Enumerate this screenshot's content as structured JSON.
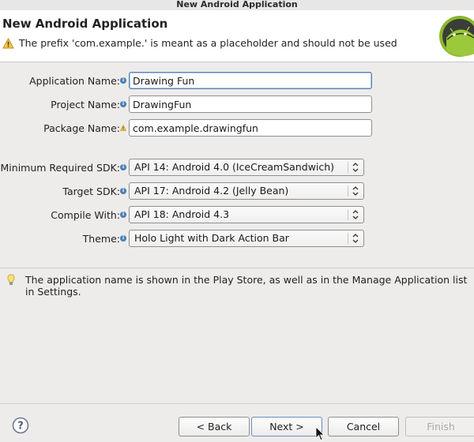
{
  "window": {
    "title": "New Android Application"
  },
  "header": {
    "title": "New Android Application",
    "message": "The prefix 'com.example.' is meant as a placeholder and should not be used",
    "message_icon": "warning-icon",
    "logo": "android-logo"
  },
  "form": {
    "fields": [
      {
        "label": "Application Name:",
        "icon": "info-icon",
        "value": "Drawing Fun",
        "focused": true
      },
      {
        "label": "Project Name:",
        "icon": "info-icon",
        "value": "DrawingFun"
      },
      {
        "label": "Package Name:",
        "icon": "warning-icon",
        "value": "com.example.drawingfun"
      }
    ],
    "selects": [
      {
        "label": "Minimum Required SDK:",
        "icon": "info-icon",
        "value": "API 14: Android 4.0 (IceCreamSandwich)"
      },
      {
        "label": "Target SDK:",
        "icon": "info-icon",
        "value": "API 17: Android 4.2 (Jelly Bean)"
      },
      {
        "label": "Compile With:",
        "icon": "info-icon",
        "value": "API 18: Android 4.3"
      },
      {
        "label": "Theme:",
        "icon": "info-icon",
        "value": "Holo Light with Dark Action Bar"
      }
    ]
  },
  "hint": {
    "icon": "lightbulb-icon",
    "text": "The application name is shown in the Play Store, as well as in the Manage Application list in Settings."
  },
  "footer": {
    "help_icon": "help-icon",
    "buttons": {
      "back": "< Back",
      "next": "Next >",
      "cancel": "Cancel",
      "finish": "Finish"
    }
  }
}
